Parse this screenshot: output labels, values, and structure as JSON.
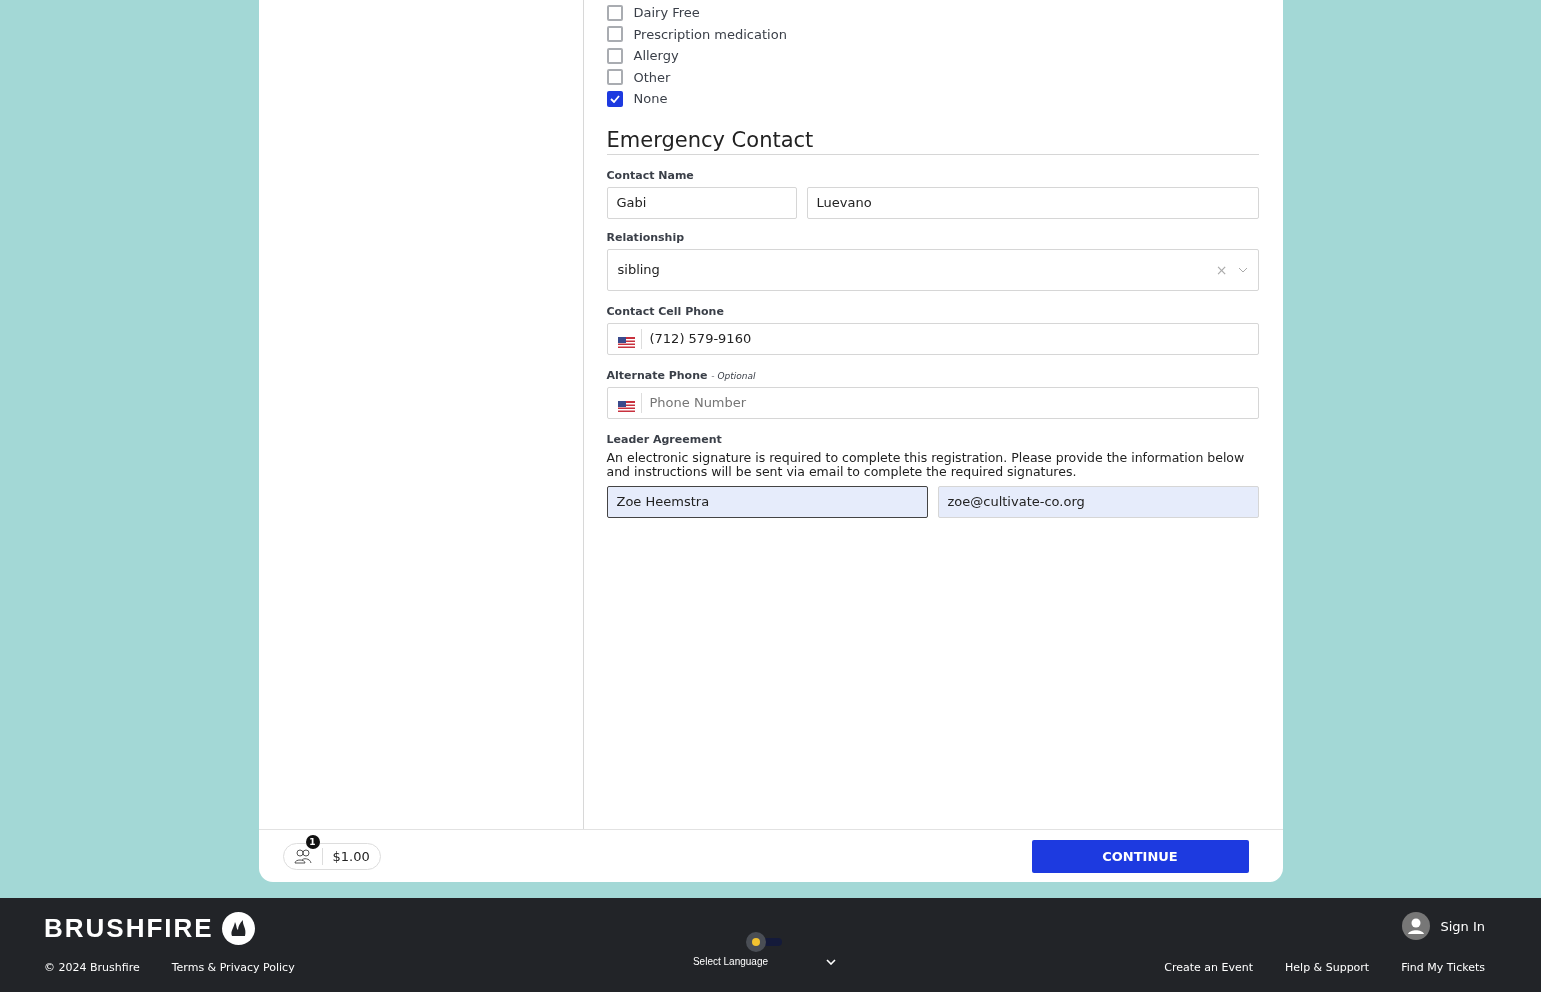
{
  "dietary_options": [
    {
      "label": "Dairy Free",
      "checked": false
    },
    {
      "label": "Prescription medication",
      "checked": false
    },
    {
      "label": "Allergy",
      "checked": false
    },
    {
      "label": "Other",
      "checked": false
    },
    {
      "label": "None",
      "checked": true
    }
  ],
  "emergency_contact": {
    "heading": "Emergency Contact",
    "contact_name": {
      "label": "Contact Name",
      "first": "Gabi",
      "last": "Luevano"
    },
    "relationship": {
      "label": "Relationship",
      "value": "sibling",
      "clear": "×"
    },
    "cell_phone": {
      "label": "Contact Cell Phone",
      "value": "(712) 579-9160"
    },
    "alternate_phone": {
      "label": "Alternate Phone",
      "optional": "- Optional",
      "placeholder": "Phone Number"
    },
    "leader_agreement": {
      "label": "Leader Agreement",
      "text": "An electronic signature is required to complete this registration. Please provide the information below and instructions will be sent via email to complete the required signatures.",
      "name": "Zoe Heemstra",
      "email": "zoe@cultivate-co.org"
    }
  },
  "cart": {
    "count": "1",
    "total": "$1.00"
  },
  "continue_button": "CONTINUE",
  "footer": {
    "logo": "BRUSHFIRE",
    "copyright": "© 2024 Brushfire",
    "terms": "Terms & Privacy Policy",
    "language": "Select Language",
    "sign_in": "Sign In",
    "links": [
      "Create an Event",
      "Help & Support",
      "Find My Tickets"
    ]
  }
}
